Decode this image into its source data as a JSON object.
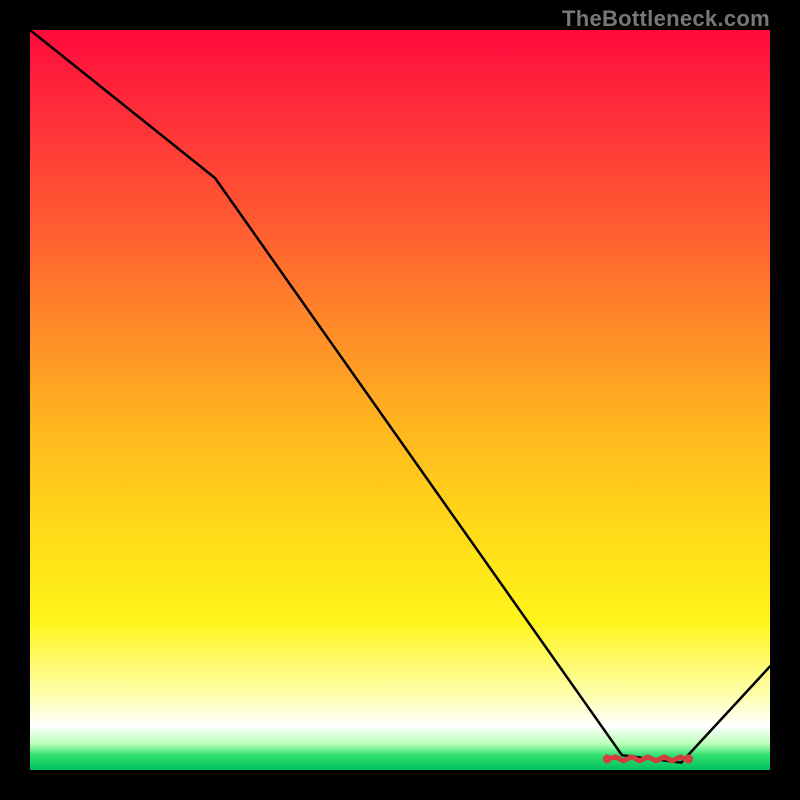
{
  "watermark": "TheBottleneck.com",
  "chart_data": {
    "type": "line",
    "title": "",
    "xlabel": "",
    "ylabel": "",
    "xlim": [
      0,
      100
    ],
    "ylim": [
      0,
      100
    ],
    "x": [
      0,
      25,
      80,
      88,
      100
    ],
    "values": [
      100,
      80,
      2,
      1,
      14
    ],
    "marker_range_x": [
      78,
      89
    ],
    "marker_y": 1.5,
    "annotations": [],
    "gradient_stops": [
      {
        "pos": 0.0,
        "color": "#ff0a3c"
      },
      {
        "pos": 0.1,
        "color": "#ff2a3a"
      },
      {
        "pos": 0.25,
        "color": "#ff5732"
      },
      {
        "pos": 0.4,
        "color": "#ff8a28"
      },
      {
        "pos": 0.55,
        "color": "#ffba1e"
      },
      {
        "pos": 0.7,
        "color": "#ffe018"
      },
      {
        "pos": 0.8,
        "color": "#fff41a"
      },
      {
        "pos": 0.9,
        "color": "#ffffb0"
      },
      {
        "pos": 0.94,
        "color": "#ffffff"
      },
      {
        "pos": 0.965,
        "color": "#b8ffb8"
      },
      {
        "pos": 0.98,
        "color": "#30e070"
      },
      {
        "pos": 1.0,
        "color": "#00c060"
      }
    ]
  }
}
